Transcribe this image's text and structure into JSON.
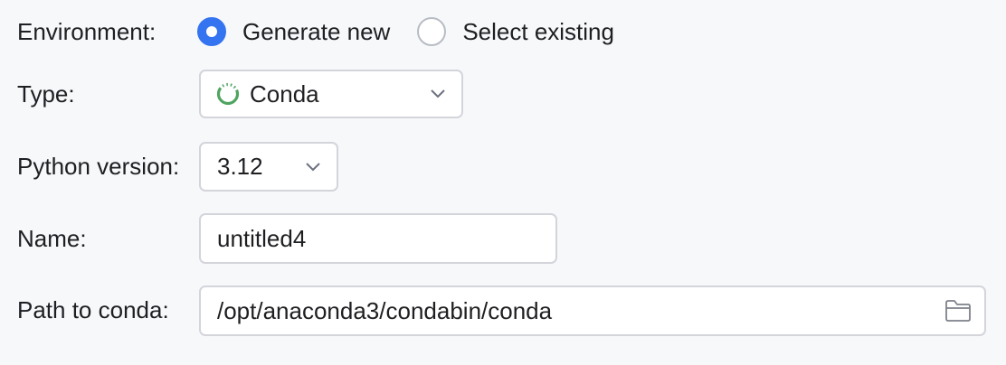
{
  "environment": {
    "label": "Environment:",
    "options": [
      {
        "label": "Generate new",
        "selected": true
      },
      {
        "label": "Select existing",
        "selected": false
      }
    ]
  },
  "type": {
    "label": "Type:",
    "value": "Conda",
    "icon": "conda-icon"
  },
  "python_version": {
    "label": "Python version:",
    "value": "3.12"
  },
  "name": {
    "label": "Name:",
    "value": "untitled4"
  },
  "path_to_conda": {
    "label": "Path to conda:",
    "value": "/opt/anaconda3/condabin/conda",
    "icon": "folder-icon"
  },
  "colors": {
    "accent": "#3574f0",
    "conda_green": "#4fa45f",
    "background": "#f7f8fa"
  }
}
